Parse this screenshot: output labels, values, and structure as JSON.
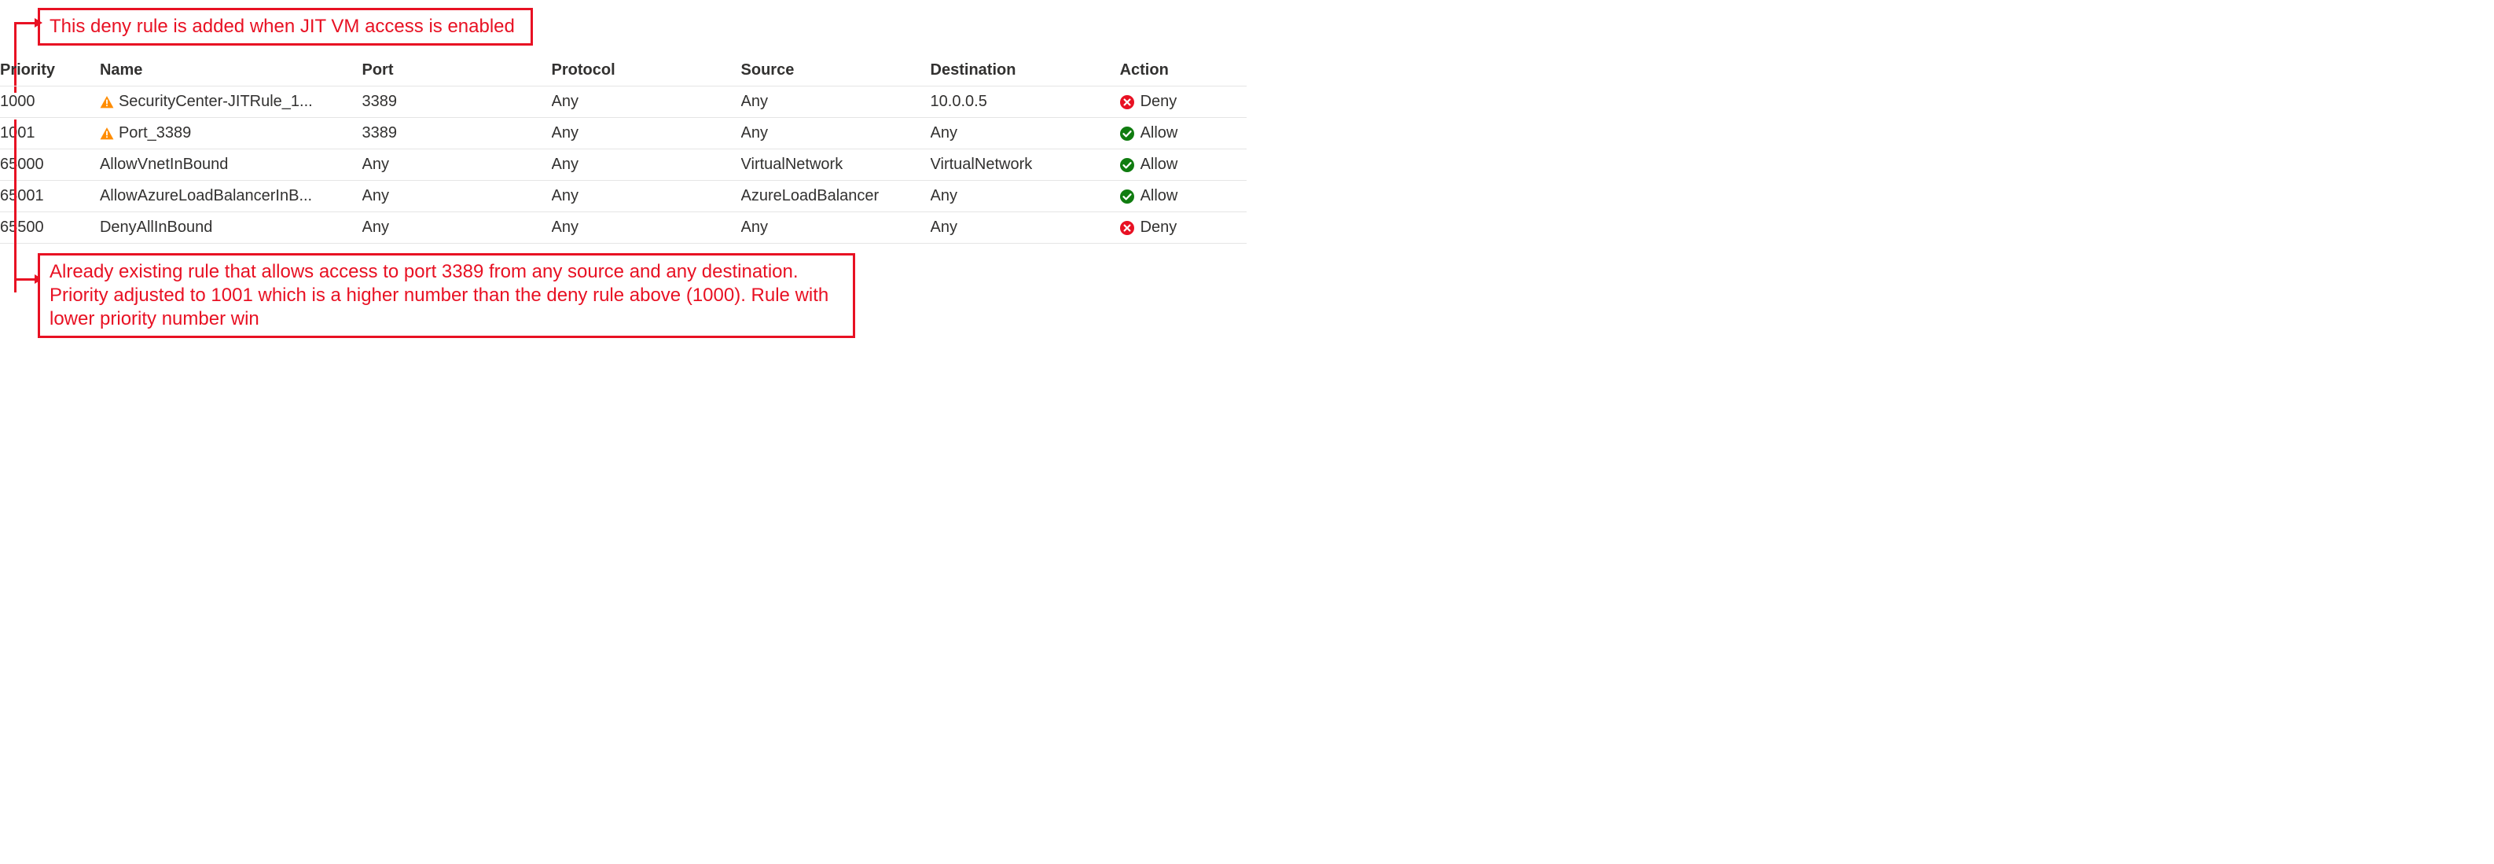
{
  "annotations": {
    "top": "This deny rule is added when JIT VM access is enabled",
    "bottom": "Already existing rule that allows access to port 3389 from any source and any destination. Priority adjusted to 1001 which is a higher number than the deny rule above (1000). Rule with lower priority number win"
  },
  "columns": {
    "priority": "Priority",
    "name": "Name",
    "port": "Port",
    "protocol": "Protocol",
    "source": "Source",
    "destination": "Destination",
    "action": "Action"
  },
  "rows": [
    {
      "priority": "1000",
      "icon": "warning",
      "name": "SecurityCenter-JITRule_1...",
      "port": "3389",
      "protocol": "Any",
      "source": "Any",
      "destination": "10.0.0.5",
      "action_icon": "deny",
      "action": "Deny"
    },
    {
      "priority": "1001",
      "icon": "warning",
      "name": "Port_3389",
      "port": "3389",
      "protocol": "Any",
      "source": "Any",
      "destination": "Any",
      "action_icon": "allow",
      "action": "Allow"
    },
    {
      "priority": "65000",
      "icon": "",
      "name": "AllowVnetInBound",
      "port": "Any",
      "protocol": "Any",
      "source": "VirtualNetwork",
      "destination": "VirtualNetwork",
      "action_icon": "allow",
      "action": "Allow"
    },
    {
      "priority": "65001",
      "icon": "",
      "name": "AllowAzureLoadBalancerInB...",
      "port": "Any",
      "protocol": "Any",
      "source": "AzureLoadBalancer",
      "destination": "Any",
      "action_icon": "allow",
      "action": "Allow"
    },
    {
      "priority": "65500",
      "icon": "",
      "name": "DenyAllInBound",
      "port": "Any",
      "protocol": "Any",
      "source": "Any",
      "destination": "Any",
      "action_icon": "deny",
      "action": "Deny"
    }
  ],
  "colors": {
    "annotation": "#e81123",
    "warning": "#ff8c00",
    "allow": "#107c10",
    "deny": "#e81123"
  }
}
